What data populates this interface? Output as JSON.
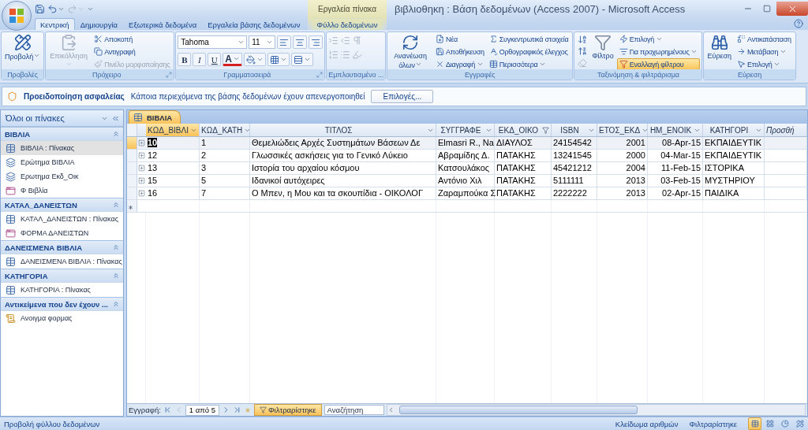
{
  "title_bar": {
    "context_label": "Εργαλεία πίνακα",
    "title": "βιβλιοθηκη : Βάση δεδομένων (Access 2007) - Microsoft Access"
  },
  "ribbon_tabs": [
    {
      "label": "Κεντρική",
      "selected": true,
      "contextual": false
    },
    {
      "label": "Δημιουργία",
      "selected": false,
      "contextual": false
    },
    {
      "label": "Εξωτερικά δεδομένα",
      "selected": false,
      "contextual": false
    },
    {
      "label": "Εργαλεία βάσης δεδομένων",
      "selected": false,
      "contextual": false
    },
    {
      "label": "Φύλλο δεδομένων",
      "selected": false,
      "contextual": true
    }
  ],
  "ribbon_groups": [
    {
      "kind": "commands",
      "label": "Προβολές",
      "launcher": false,
      "large": [
        {
          "label": "Προβολή",
          "dropdown": true,
          "disabled": false
        }
      ]
    },
    {
      "kind": "commands",
      "label": "Πρόχειρο",
      "launcher": true,
      "large": [
        {
          "label": "Επικόλληση",
          "dropdown": true,
          "disabled": true
        }
      ],
      "small": [
        {
          "label": "Αποκοπή",
          "dropdown": false,
          "disabled": false
        },
        {
          "label": "Αντιγραφή",
          "dropdown": false,
          "disabled": false
        },
        {
          "label": "Πινέλο μορφοποίησης",
          "dropdown": false,
          "disabled": true
        }
      ]
    },
    {
      "kind": "font",
      "label": "Γραμματοσειρά",
      "launcher": true,
      "font": "Tahoma",
      "size": "11",
      "format_buttons": [
        "B",
        "I",
        "U"
      ],
      "color_button": "A"
    },
    {
      "kind": "rich_text",
      "label": "Εμπλουτισμένο ...",
      "disabled": true
    },
    {
      "kind": "commands",
      "label": "Εγγραφές",
      "launcher": false,
      "large": [
        {
          "label": "Ανανέωση όλων",
          "dropdown": true,
          "disabled": false
        }
      ],
      "small": [
        {
          "label": "Νέα",
          "dropdown": false,
          "disabled": false
        },
        {
          "label": "Αποθήκευση",
          "dropdown": false,
          "disabled": false
        },
        {
          "label": "Διαγραφή",
          "dropdown": true,
          "disabled": false
        },
        {
          "label": "Συγκεντρωτικά στοιχεία",
          "dropdown": false,
          "disabled": false
        },
        {
          "label": "Ορθογραφικός έλεγχος",
          "dropdown": false,
          "disabled": false
        },
        {
          "label": "Περισσότερα",
          "dropdown": true,
          "disabled": false
        }
      ]
    },
    {
      "kind": "commands",
      "label": "Ταξινόμηση & φιλτράρισμα",
      "launcher": false,
      "icon_buttons": [
        {
          "disabled": false
        },
        {
          "disabled": false
        },
        {
          "disabled": true
        }
      ],
      "large": [
        {
          "label": "Φίλτρο",
          "dropdown": false,
          "disabled": false,
          "on": false
        }
      ],
      "small": [
        {
          "label": "Επιλογή",
          "dropdown": true,
          "disabled": false,
          "on": false
        },
        {
          "label": "Για προχωρημένους",
          "dropdown": true,
          "disabled": false,
          "on": false
        },
        {
          "label": "Εναλλαγή φίλτρου",
          "dropdown": false,
          "disabled": false,
          "on": true
        }
      ]
    },
    {
      "kind": "commands",
      "label": "Εύρεση",
      "launcher": false,
      "large": [
        {
          "label": "Εύρεση",
          "dropdown": false,
          "disabled": false
        }
      ],
      "small": [
        {
          "label": "Αντικατάσταση",
          "dropdown": false,
          "disabled": false
        },
        {
          "label": "Μετάβαση",
          "dropdown": true,
          "disabled": false
        },
        {
          "label": "Επιλογή",
          "dropdown": true,
          "disabled": false
        }
      ]
    }
  ],
  "security_bar": {
    "title": "Προειδοποίηση ασφαλείας",
    "message": "Κάποια περιεχόμενα της βάσης δεδομένων έχουν απενεργοποιηθεί",
    "button": "Επιλογές..."
  },
  "nav_pane": {
    "title": "Όλοι οι πίνακες",
    "sections": [
      {
        "title": "ΒΙΒΛΙΑ",
        "items": [
          {
            "label": "ΒΙΒΛΙΑ : Πίνακας",
            "kind": "table",
            "selected": true
          },
          {
            "label": "Ερώτημα ΒΙΒΛΙΑ",
            "kind": "query",
            "selected": false
          },
          {
            "label": "Ερωτημα Εκδ_Οικ",
            "kind": "query",
            "selected": false
          },
          {
            "label": "Φ Βιβλία",
            "kind": "form",
            "selected": false
          }
        ]
      },
      {
        "title": "ΚΑΤΑΛ_ΔΑΝΕΙΣΤΩΝ",
        "items": [
          {
            "label": "ΚΑΤΑΛ_ΔΑΝΕΙΣΤΩΝ : Πίνακας",
            "kind": "table",
            "selected": false
          },
          {
            "label": "ΦΟΡΜΑ ΔΑΝΕΙΣΤΩΝ",
            "kind": "form",
            "selected": false
          }
        ]
      },
      {
        "title": "ΔΑΝΕΙΣΜΕΝΑ ΒΙΒΛΙΑ",
        "items": [
          {
            "label": "ΔΑΝΕΙΣΜΕΝΑ ΒΙΒΛΙΑ : Πίνακας",
            "kind": "table",
            "selected": false
          }
        ]
      },
      {
        "title": "ΚΑΤΗΓΟΡΙΑ",
        "items": [
          {
            "label": "ΚΑΤΗΓΟΡΙΑ : Πίνακας",
            "kind": "table",
            "selected": false
          }
        ]
      },
      {
        "title": "Αντικείμενα που δεν έχουν ...",
        "items": [
          {
            "label": "Ανοιγμα φορμας",
            "kind": "macro",
            "selected": false
          }
        ]
      }
    ]
  },
  "document_tab": {
    "label": "ΒΙΒΛΙΑ"
  },
  "table": {
    "columns": [
      {
        "label": "ΚΩΔ_ΒΙΒΛΙ",
        "kind": "field",
        "numeric": false,
        "filtered": false
      },
      {
        "label": "ΚΩΔ_ΚΑΤΗ",
        "kind": "field",
        "numeric": false,
        "filtered": false
      },
      {
        "label": "ΤΙΤΛΟΣ",
        "kind": "field",
        "numeric": false,
        "filtered": false
      },
      {
        "label": "ΣΥΓΓΡΑΦΕ",
        "kind": "field",
        "numeric": false,
        "filtered": false
      },
      {
        "label": "ΕΚΔ_ΟΙΚΟ",
        "kind": "field",
        "numeric": false,
        "filtered": true
      },
      {
        "label": "ISBN",
        "kind": "field",
        "numeric": false,
        "filtered": false
      },
      {
        "label": "ΕΤΟΣ_ΕΚΔ",
        "kind": "field",
        "numeric": true,
        "filtered": false
      },
      {
        "label": "ΗΜ_ΕΝΟΙΚ",
        "kind": "field",
        "numeric": true,
        "filtered": false
      },
      {
        "label": "ΚΑΤΗΓΟΡΙ",
        "kind": "field",
        "numeric": false,
        "filtered": false
      },
      {
        "label": "Προσθή",
        "kind": "add"
      }
    ],
    "rows": [
      {
        "selected": true,
        "cells": [
          "10",
          "1",
          "Θεμελιώδεις Αρχές Συστημάτων Βάσεων Δε",
          "Elmasri R., Na",
          "ΔΙΑΥΛΟΣ",
          "24154542",
          "2001",
          "08-Apr-15",
          "ΕΚΠΑΙΔΕΥΤΙΚ"
        ]
      },
      {
        "selected": false,
        "cells": [
          "12",
          "2",
          "Γλωσσικές ασκήσεις για το Γενικό Λύκειο",
          "Αβραμίδης Δ.",
          "ΠΑΤΑΚΗΣ",
          "13241545",
          "2000",
          "04-Mar-15",
          "ΕΚΠΑΙΔΕΥΤΙΚ"
        ]
      },
      {
        "selected": false,
        "cells": [
          "13",
          "3",
          "Ιστορία του αρχαίου κόσμου",
          "Κατσουλάκος",
          "ΠΑΤΑΚΗΣ",
          "45421212",
          "2004",
          "11-Feb-15",
          "ΙΣΤΟΡΙΚΑ"
        ]
      },
      {
        "selected": false,
        "cells": [
          "15",
          "5",
          "Ιδανικοί αυτόχειρες",
          "Αντόνιο Χιλ",
          "ΠΑΤΑΚΗΣ",
          "5111111",
          "2013",
          "03-Feb-15",
          "ΜΥΣΤΗΡΙΟΥ"
        ]
      },
      {
        "selected": false,
        "cells": [
          "16",
          "7",
          "Ο Μπεν, η Μου και τα σκουπίδια - ΟΙΚΟΛΟΓ",
          "Ζαραμπούκα Σ",
          "ΠΑΤΑΚΗΣ",
          "2222222",
          "2013",
          "02-Apr-15",
          "ΠΑΙΔΙΚΑ"
        ]
      }
    ]
  },
  "record_nav": {
    "label": "Εγγραφή:",
    "position": "1 από 5",
    "filter": "Φιλτραρίστηκε",
    "filtered": true,
    "search_placeholder": "Αναζήτηση"
  },
  "status_bar": {
    "left": "Προβολή φύλλου δεδομένων",
    "indicators": [
      "Κλείδωμα αριθμών",
      "Φιλτραρίστηκε"
    ],
    "views": [
      {
        "selected": true
      },
      {
        "selected": false
      },
      {
        "selected": false
      },
      {
        "selected": false
      }
    ]
  }
}
